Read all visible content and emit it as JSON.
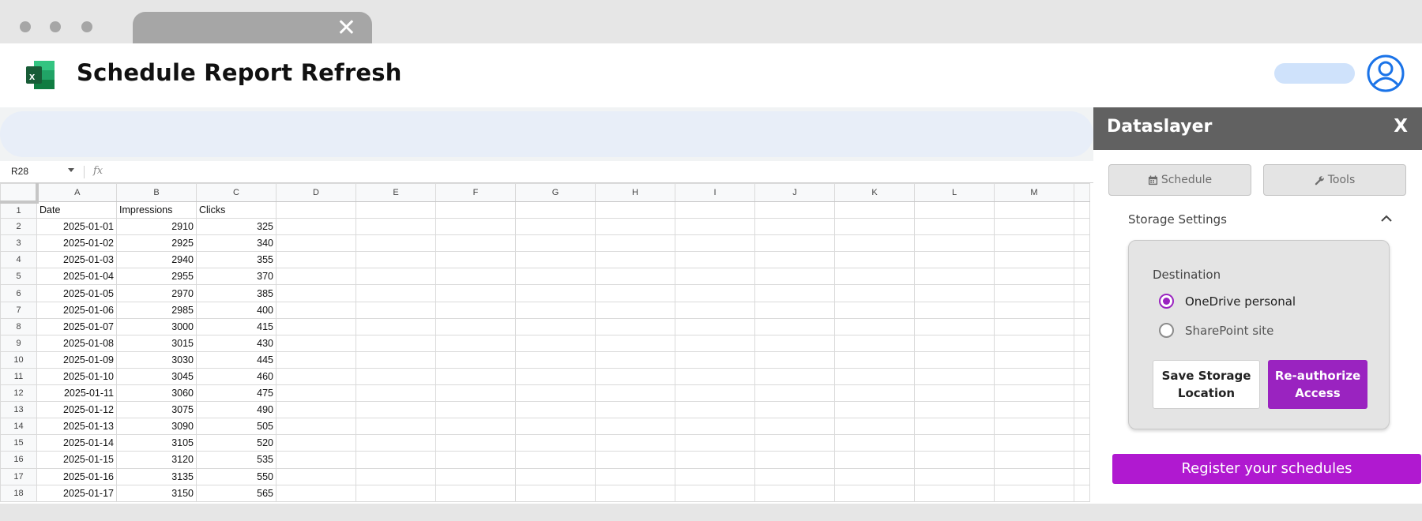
{
  "browser": {
    "tab_close": "✕"
  },
  "app": {
    "title": "Schedule Report Refresh"
  },
  "sheet": {
    "name_box": "R28",
    "fx": "fx",
    "columns": [
      "A",
      "B",
      "C",
      "D",
      "E",
      "F",
      "G",
      "H",
      "I",
      "J",
      "K",
      "L",
      "M"
    ],
    "header_row": [
      "Date",
      "Impressions",
      "Clicks"
    ],
    "rows": [
      [
        "2025-01-01",
        "2910",
        "325"
      ],
      [
        "2025-01-02",
        "2925",
        "340"
      ],
      [
        "2025-01-03",
        "2940",
        "355"
      ],
      [
        "2025-01-04",
        "2955",
        "370"
      ],
      [
        "2025-01-05",
        "2970",
        "385"
      ],
      [
        "2025-01-06",
        "2985",
        "400"
      ],
      [
        "2025-01-07",
        "3000",
        "415"
      ],
      [
        "2025-01-08",
        "3015",
        "430"
      ],
      [
        "2025-01-09",
        "3030",
        "445"
      ],
      [
        "2025-01-10",
        "3045",
        "460"
      ],
      [
        "2025-01-11",
        "3060",
        "475"
      ],
      [
        "2025-01-12",
        "3075",
        "490"
      ],
      [
        "2025-01-13",
        "3090",
        "505"
      ],
      [
        "2025-01-14",
        "3105",
        "520"
      ],
      [
        "2025-01-15",
        "3120",
        "535"
      ],
      [
        "2025-01-16",
        "3135",
        "550"
      ],
      [
        "2025-01-17",
        "3150",
        "565"
      ]
    ]
  },
  "panel": {
    "title": "Dataslayer",
    "close_label": "X",
    "tabs": {
      "schedule": "Schedule",
      "tools": "Tools"
    },
    "storage_settings_label": "Storage Settings",
    "destination_label": "Destination",
    "options": [
      {
        "label": "OneDrive personal",
        "checked": true
      },
      {
        "label": "SharePoint site",
        "checked": false
      }
    ],
    "save_button": "Save Storage Location",
    "reauth_button": "Re-authorize Access",
    "register_button": "Register your schedules"
  },
  "colors": {
    "accent": "#9a23c0",
    "register": "#b019d0",
    "panel_header": "#616161",
    "excel_green": "#107c41"
  }
}
